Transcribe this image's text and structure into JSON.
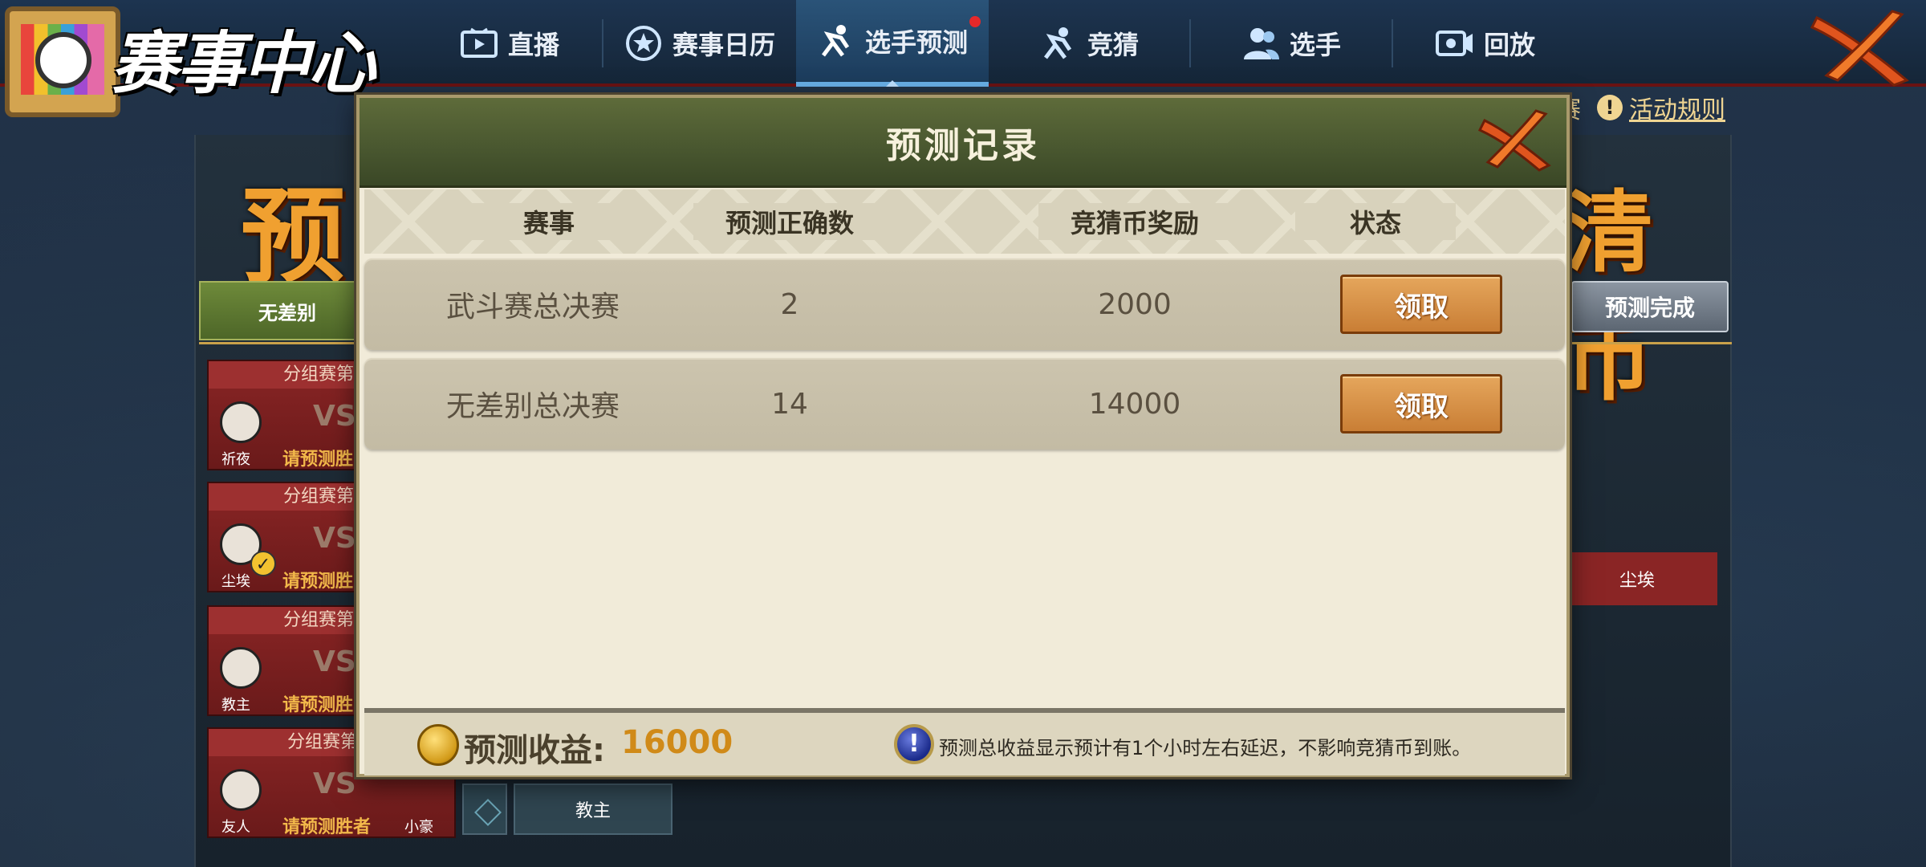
{
  "nav": {
    "logo_title": "赛事中心",
    "items": [
      {
        "label": "直播",
        "icon": "tv-play-icon",
        "active": false
      },
      {
        "label": "赛事日历",
        "icon": "star-badge-icon",
        "active": false
      },
      {
        "label": "选手预测",
        "icon": "ninja-run-icon",
        "active": true,
        "badge_dot": true
      },
      {
        "label": "竞猜",
        "icon": "ninja-run-icon",
        "active": false
      },
      {
        "label": "选手",
        "icon": "users-icon",
        "active": false
      },
      {
        "label": "回放",
        "icon": "video-camera-icon",
        "active": false
      }
    ],
    "rules_link": "活动规则",
    "rules_prev_fragment": "赛"
  },
  "background": {
    "banner_left": "预",
    "banner_right": "清币",
    "tab_label": "无差别",
    "predict_done": "预测完成",
    "matches": [
      {
        "title": "分组赛第一",
        "vs": "VS",
        "player": "祈夜",
        "hint": "请预测胜",
        "checked": false
      },
      {
        "title": "分组赛第二",
        "vs": "VS",
        "player": "尘埃",
        "hint": "请预测胜",
        "checked": true
      },
      {
        "title": "分组赛第三",
        "vs": "VS",
        "player": "教主",
        "hint": "请预测胜",
        "checked": false
      },
      {
        "title": "分组赛第四",
        "vs": "VS",
        "player": "友人",
        "hint": "请预测胜者",
        "checked": false,
        "opponent": "小豪"
      }
    ],
    "right_card": "尘埃",
    "bottom_card": "教主",
    "bottom_card_small": "友人"
  },
  "modal": {
    "title": "预测记录",
    "columns": [
      "赛事",
      "预测正确数",
      "竞猜币奖励",
      "状态"
    ],
    "rows": [
      {
        "event": "武斗赛总决赛",
        "correct": "2",
        "reward": "2000",
        "action": "领取"
      },
      {
        "event": "无差别总决赛",
        "correct": "14",
        "reward": "14000",
        "action": "领取"
      }
    ],
    "income_label": "预测收益:",
    "income_value": "16000",
    "note": "预测总收益显示预计有1个小时左右延迟，不影响竞猜币到账。"
  },
  "colors": {
    "header_green": "#4a5830",
    "claim_orange": "#c97e35",
    "income_gold": "#d08a18",
    "nav_bg": "#1d3450"
  }
}
